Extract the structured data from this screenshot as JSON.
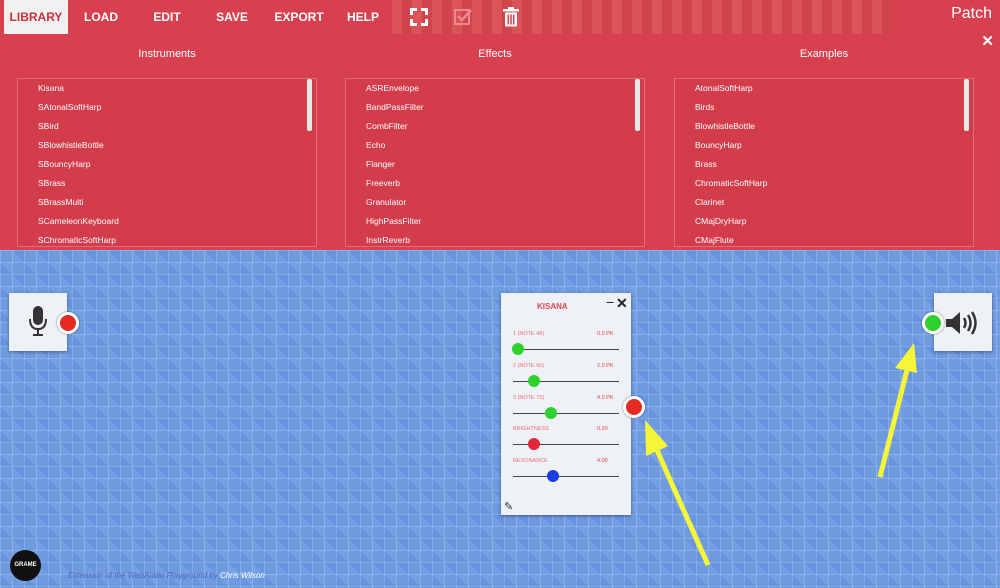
{
  "menu": {
    "tabs": [
      "LIBRARY",
      "LOAD",
      "EDIT",
      "SAVE",
      "EXPORT",
      "HELP"
    ],
    "active": "LIBRARY",
    "tool_icons": [
      "fullscreen-icon",
      "checkbox-icon",
      "trash-icon"
    ],
    "patch_title": "Patch"
  },
  "library": {
    "close_glyph": "✕",
    "columns": [
      {
        "title": "Instruments",
        "items": [
          "Kisana",
          "SAtonalSoftHarp",
          "SBird",
          "SBlowhistleBottle",
          "SBouncyHarp",
          "SBrass",
          "SBrassMulti",
          "SCameleonKeyboard",
          "SChromaticSoftHarp"
        ]
      },
      {
        "title": "Effects",
        "items": [
          "ASREnvelope",
          "BandPassFilter",
          "CombFilter",
          "Echo",
          "Flanger",
          "Freeverb",
          "Granulator",
          "HighPassFilter",
          "InstrReverb"
        ]
      },
      {
        "title": "Examples",
        "items": [
          "AtonalSoftHarp",
          "Birds",
          "BlowhistleBottle",
          "BouncyHarp",
          "Brass",
          "ChromaticSoftHarp",
          "Clarinet",
          "CMajDryHarp",
          "CMajFlute"
        ]
      }
    ]
  },
  "nodes": {
    "input_icon": "microphone-icon",
    "output_icon": "speaker-icon",
    "kisana": {
      "title": "KISANA",
      "minimize": "−",
      "close": "✕",
      "params": [
        {
          "label": "1 (NOTE 48)",
          "value": "0.0 PK",
          "level": 0.05,
          "color": "#2fd12f"
        },
        {
          "label": "2 (NOTE 60)",
          "value": "2.0 PK",
          "level": 0.2,
          "color": "#2fd12f"
        },
        {
          "label": "3 (NOTE 72)",
          "value": "4.0 PK",
          "level": 0.36,
          "color": "#2fd12f"
        },
        {
          "label": "BRIGHTNESS",
          "value": "0.20",
          "level": 0.2,
          "color": "#e5263a"
        },
        {
          "label": "RESONANCE",
          "value": "4.00",
          "level": 0.38,
          "color": "#1a3ee0"
        }
      ]
    }
  },
  "footer": {
    "credit_text": "Extension of the WebAudio Playground by ",
    "credit_link": "Chris Wilson",
    "logo_text": "GRAME"
  }
}
